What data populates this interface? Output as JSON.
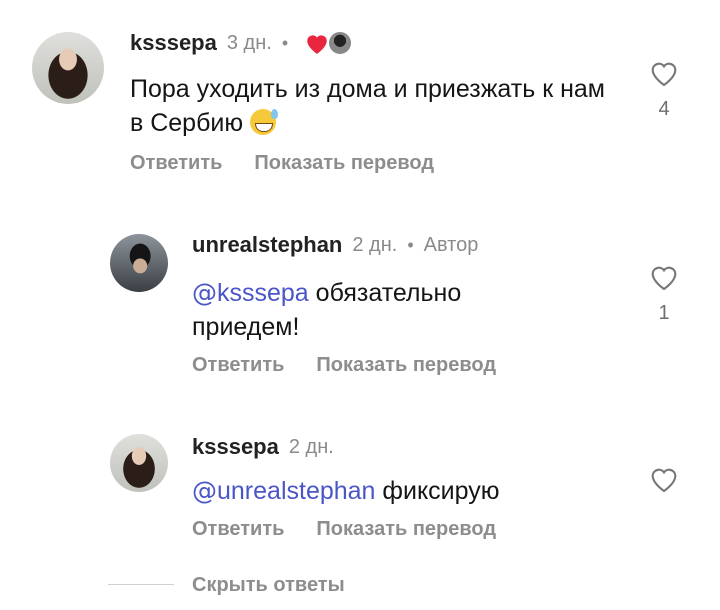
{
  "comments": [
    {
      "username": "ksssepa",
      "time": "3 дн.",
      "dot": "•",
      "text": "Пора уходить из дома и приезжать к нам в Сербию",
      "emoji": "sweat-smile-emoji",
      "likes": "4",
      "actions": {
        "reply": "Ответить",
        "translate": "Показать перевод"
      },
      "liked_by_author_icon": "heart-icon"
    },
    {
      "username": "unrealstephan",
      "time": "2 дн.",
      "dot": "•",
      "badge": "Автор",
      "mention": "ksssepa",
      "text": " обязательно приедем!",
      "likes": "1",
      "actions": {
        "reply": "Ответить",
        "translate": "Показать перевод"
      }
    },
    {
      "username": "ksssepa",
      "time": "2 дн.",
      "mention": "unrealstephan",
      "text": " фиксирую",
      "actions": {
        "reply": "Ответить",
        "translate": "Показать перевод"
      }
    }
  ],
  "hide_replies": "Скрыть ответы",
  "mention_prefix": "@",
  "colors": {
    "mention": "#4a55c8",
    "muted": "#8d8d8d",
    "heart": "#e8263d"
  }
}
